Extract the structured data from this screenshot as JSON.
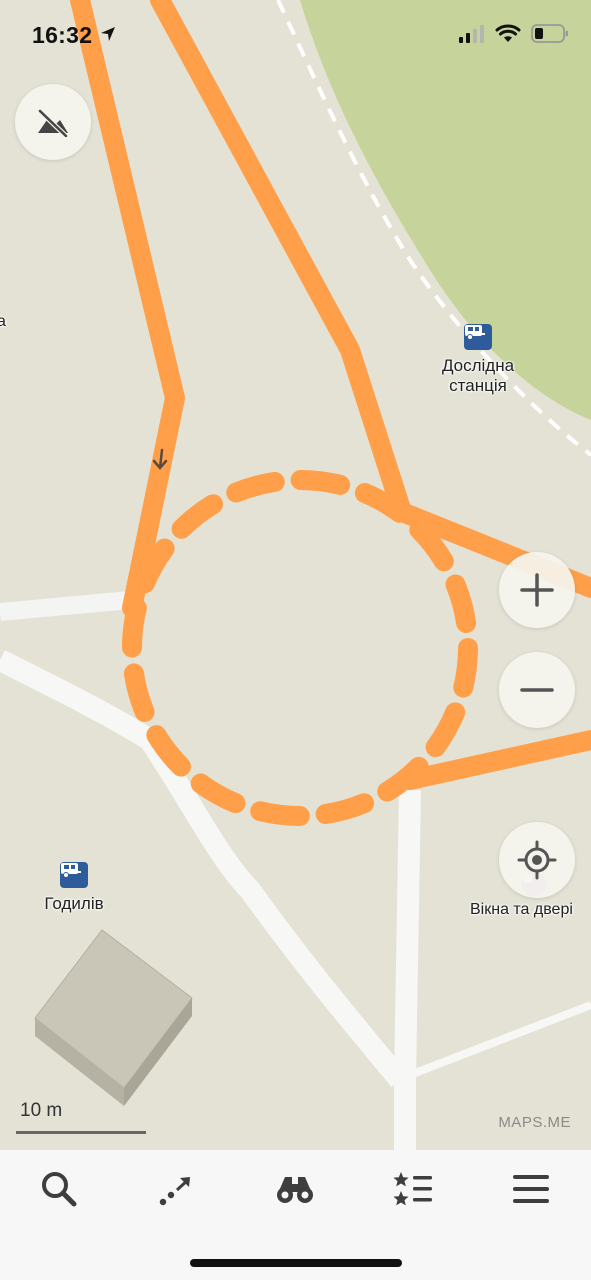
{
  "status_bar": {
    "time": "16:32",
    "location_arrow_icon": "location-arrow-icon",
    "signal_icon": "cellular-signal-icon",
    "wifi_icon": "wifi-icon",
    "battery_icon": "battery-low-icon"
  },
  "map": {
    "colors": {
      "land": "#e4e2d4",
      "park": "#c6d39a",
      "path": "#ff9f4a",
      "road": "#ffffff"
    },
    "pois": [
      {
        "name": "Дослідна\nстанція",
        "icon": "camper-icon"
      },
      {
        "name": "Годилів",
        "icon": "camper-icon"
      },
      {
        "name": "Вікна та двері",
        "icon": "shop-icon"
      }
    ],
    "edge_label_fragment": "а",
    "scale_label": "10 m",
    "watermark": "MAPS.ME"
  },
  "controls": {
    "terrain_icon": "terrain-off-icon",
    "zoom_in_icon": "plus-icon",
    "zoom_out_icon": "minus-icon",
    "locate_icon": "my-location-icon"
  },
  "toolbar": {
    "items": [
      {
        "icon": "search-icon"
      },
      {
        "icon": "route-icon"
      },
      {
        "icon": "binoculars-icon"
      },
      {
        "icon": "bookmarks-icon"
      },
      {
        "icon": "menu-icon"
      }
    ]
  }
}
